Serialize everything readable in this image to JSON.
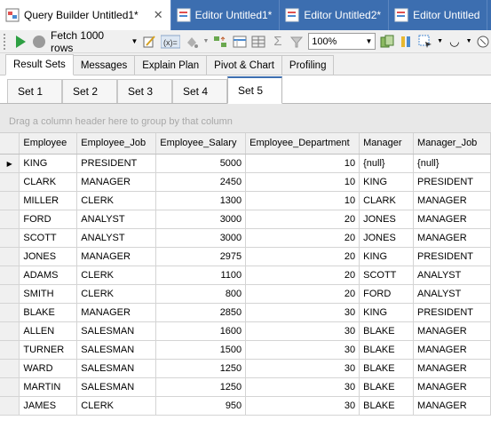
{
  "doc_tabs": [
    {
      "label": "Query Builder Untitled1*",
      "active": true,
      "closable": true,
      "icon": "query-builder-icon"
    },
    {
      "label": "Editor Untitled1*",
      "active": false,
      "closable": false,
      "icon": "sql-editor-icon"
    },
    {
      "label": "Editor Untitled2*",
      "active": false,
      "closable": false,
      "icon": "sql-editor-icon"
    },
    {
      "label": "Editor Untitled",
      "active": false,
      "closable": false,
      "icon": "sql-editor-icon"
    }
  ],
  "toolbar": {
    "fetch_label": "Fetch 1000 rows",
    "zoom_value": "100%"
  },
  "result_tabs": [
    "Result Sets",
    "Messages",
    "Explain Plan",
    "Pivot & Chart",
    "Profiling"
  ],
  "set_tabs": [
    "Set 1",
    "Set 2",
    "Set 3",
    "Set 4",
    "Set 5"
  ],
  "group_panel_text": "Drag a column header here to group by that column",
  "grid": {
    "columns": [
      "Employee",
      "Employee_Job",
      "Employee_Salary",
      "Employee_Department",
      "Manager",
      "Manager_Job"
    ],
    "rows": [
      [
        "KING",
        "PRESIDENT",
        "5000",
        "10",
        "{null}",
        "{null}"
      ],
      [
        "CLARK",
        "MANAGER",
        "2450",
        "10",
        "KING",
        "PRESIDENT"
      ],
      [
        "MILLER",
        "CLERK",
        "1300",
        "10",
        "CLARK",
        "MANAGER"
      ],
      [
        "FORD",
        "ANALYST",
        "3000",
        "20",
        "JONES",
        "MANAGER"
      ],
      [
        "SCOTT",
        "ANALYST",
        "3000",
        "20",
        "JONES",
        "MANAGER"
      ],
      [
        "JONES",
        "MANAGER",
        "2975",
        "20",
        "KING",
        "PRESIDENT"
      ],
      [
        "ADAMS",
        "CLERK",
        "1100",
        "20",
        "SCOTT",
        "ANALYST"
      ],
      [
        "SMITH",
        "CLERK",
        "800",
        "20",
        "FORD",
        "ANALYST"
      ],
      [
        "BLAKE",
        "MANAGER",
        "2850",
        "30",
        "KING",
        "PRESIDENT"
      ],
      [
        "ALLEN",
        "SALESMAN",
        "1600",
        "30",
        "BLAKE",
        "MANAGER"
      ],
      [
        "TURNER",
        "SALESMAN",
        "1500",
        "30",
        "BLAKE",
        "MANAGER"
      ],
      [
        "WARD",
        "SALESMAN",
        "1250",
        "30",
        "BLAKE",
        "MANAGER"
      ],
      [
        "MARTIN",
        "SALESMAN",
        "1250",
        "30",
        "BLAKE",
        "MANAGER"
      ],
      [
        "JAMES",
        "CLERK",
        "950",
        "30",
        "BLAKE",
        "MANAGER"
      ]
    ]
  },
  "colors": {
    "doc_tab_bar": "#3c6eb0",
    "run_green": "#2ea043",
    "stop_grey": "#9a9a9a"
  }
}
